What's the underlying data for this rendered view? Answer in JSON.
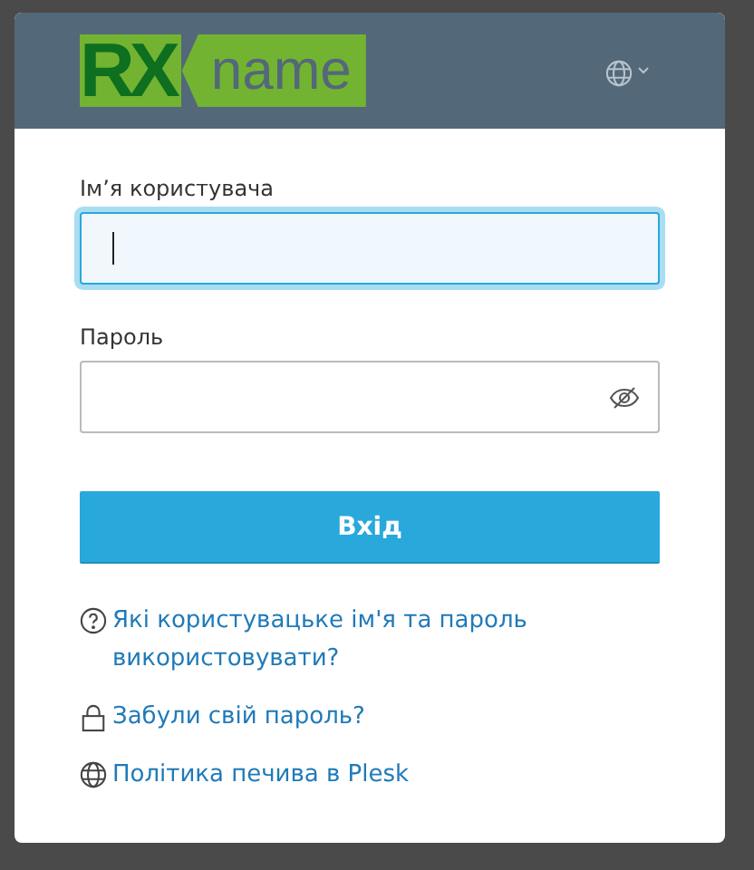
{
  "header": {
    "logo": {
      "mark": "RX",
      "word": "name"
    },
    "language_menu": {
      "expanded": false
    }
  },
  "form": {
    "fields": [
      {
        "label": "Ім’я користувача",
        "kind": "text",
        "focused": true
      },
      {
        "label": "Пароль",
        "kind": "password",
        "focused": false
      }
    ],
    "submit": "Вхід"
  },
  "links": [
    {
      "kind": "help",
      "text": "Які користувацьке ім'я та пароль використовувати?"
    },
    {
      "kind": "lock",
      "text": "Забули свій пароль?"
    },
    {
      "kind": "globe",
      "text": "Політика печива в Plesk"
    }
  ]
}
